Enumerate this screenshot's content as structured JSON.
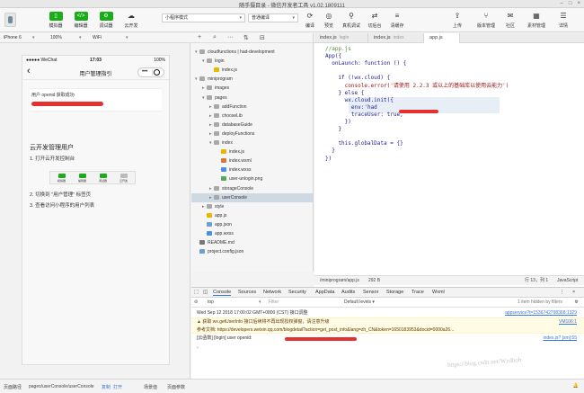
{
  "window": {
    "title": "随手摄目录 - 微信开发者工具 v1.02.1809111"
  },
  "toolbar": {
    "simulator": "模拟器",
    "editor": "编辑器",
    "debugger": "调试器",
    "cloud": "云开发",
    "mode": "小程序模式",
    "compile_mode": "普通编译",
    "compile": "编译",
    "preview": "预览",
    "remote_debug": "真机调试",
    "background": "切后台",
    "clear_cache": "清缓存",
    "upload": "上传",
    "version": "版本管理",
    "community": "社区",
    "material": "素材管理",
    "details": "详情"
  },
  "simulator_opts": {
    "device": "iPhone 6",
    "zoom": "100%",
    "network": "WiFi"
  },
  "phone": {
    "carrier": "●●●●● WeChat",
    "time": "17:03",
    "battery": "100%",
    "nav_title": "用户管理指引",
    "openid_text": "用户 openid 获取成功",
    "section_title": "云开发管理用户",
    "step1": "1. 打开云开发控制台",
    "step2": "2. 切换到 \"用户管理\" 标签页",
    "step3": "3. 查看访问小程序的用户列表",
    "mini_tools": [
      "模拟器",
      "编辑器",
      "调试器",
      "云开发"
    ]
  },
  "explorer": {
    "rows": [
      {
        "label": "cloudfunctions | had-development",
        "icon": "folder",
        "depth": 0,
        "arrow": "▾"
      },
      {
        "label": "login",
        "icon": "folder",
        "depth": 1,
        "arrow": "▾"
      },
      {
        "label": "index.js",
        "icon": "js",
        "depth": 2,
        "arrow": ""
      },
      {
        "label": "miniprogram",
        "icon": "folder",
        "depth": 0,
        "arrow": "▾"
      },
      {
        "label": "images",
        "icon": "folder",
        "depth": 1,
        "arrow": "▸"
      },
      {
        "label": "pages",
        "icon": "folder",
        "depth": 1,
        "arrow": "▾"
      },
      {
        "label": "addFunction",
        "icon": "folder",
        "depth": 2,
        "arrow": "▸"
      },
      {
        "label": "chooseLib",
        "icon": "folder",
        "depth": 2,
        "arrow": "▸"
      },
      {
        "label": "databaseGuide",
        "icon": "folder",
        "depth": 2,
        "arrow": "▸"
      },
      {
        "label": "deployFunctions",
        "icon": "folder",
        "depth": 2,
        "arrow": "▸"
      },
      {
        "label": "index",
        "icon": "folder",
        "depth": 2,
        "arrow": "▾"
      },
      {
        "label": "index.js",
        "icon": "js",
        "depth": 3,
        "arrow": ""
      },
      {
        "label": "index.wxml",
        "icon": "wxml",
        "depth": 3,
        "arrow": ""
      },
      {
        "label": "index.wxss",
        "icon": "wxss",
        "depth": 3,
        "arrow": ""
      },
      {
        "label": "user-unlogin.png",
        "icon": "png",
        "depth": 3,
        "arrow": ""
      },
      {
        "label": "storageConsole",
        "icon": "folder",
        "depth": 2,
        "arrow": "▸"
      },
      {
        "label": "userConsole",
        "icon": "folder",
        "depth": 2,
        "arrow": "▸",
        "selected": true
      },
      {
        "label": "style",
        "icon": "folder",
        "depth": 1,
        "arrow": "▸"
      },
      {
        "label": "app.js",
        "icon": "js",
        "depth": 1,
        "arrow": ""
      },
      {
        "label": "app.json",
        "icon": "json",
        "depth": 1,
        "arrow": ""
      },
      {
        "label": "app.wxss",
        "icon": "wxss",
        "depth": 1,
        "arrow": ""
      },
      {
        "label": "README.md",
        "icon": "md",
        "depth": 0,
        "arrow": ""
      },
      {
        "label": "project.config.json",
        "icon": "json",
        "depth": 0,
        "arrow": ""
      }
    ]
  },
  "editor": {
    "tabs": [
      {
        "name": "index.js",
        "path": "login"
      },
      {
        "name": "index.js",
        "path": "index"
      },
      {
        "name": "app.js",
        "path": ""
      }
    ],
    "code": [
      "//app.js",
      "App({",
      "  onLaunch: function () {",
      "",
      "    if (!wx.cloud) {",
      "      console.error('请使用 2.2.3 或以上的基础库以使用云能力')",
      "    } else {",
      "      wx.cloud.init({",
      "        env:'had",
      "        traceUser: true,",
      "      })",
      "    }",
      "",
      "    this.globalData = {}",
      "  }",
      "})"
    ],
    "status_path": "/miniprogram/app.js",
    "status_size": "292 B",
    "status_pos": "行 13，列 1",
    "status_lang": "JavaScript"
  },
  "console": {
    "tabs": [
      "Console",
      "Sources",
      "Network",
      "Security",
      "AppData",
      "Audits",
      "Sensor",
      "Storage",
      "Trace",
      "Wxml"
    ],
    "context": "top",
    "filter_placeholder": "Filter",
    "levels": "Default levels ▾",
    "hidden": "1 item hidden by filters",
    "logs": [
      {
        "text": "Wed Sep 12 2018 17:00:02 GMT+0800 (CST) 接口调整",
        "src": "appservice?t=1536742798368:1329"
      },
      {
        "text": "▲ 获取 wx.getUserInfo 接口后续将不再出现授权弹窗，请注意升级",
        "src": "VM106:1"
      },
      {
        "text": "   参考文档: https://developers.weixin.qq.com/blogdetail?action=get_post_info&lang=zh_CN&token=1650183953&docid=0000a26...",
        "src": ""
      },
      {
        "text": "[云函数] [login] user openid:",
        "src": "index.js? [sm]:55"
      }
    ],
    "prompt": "›"
  },
  "bottom": {
    "label": "页面路径",
    "path": "pages/userConsole/userConsole",
    "copy": "复制",
    "open": "打开",
    "scene": "场景值",
    "params": "页面参数"
  },
  "watermark": "https://blog.csdn.net/Wzdbob"
}
